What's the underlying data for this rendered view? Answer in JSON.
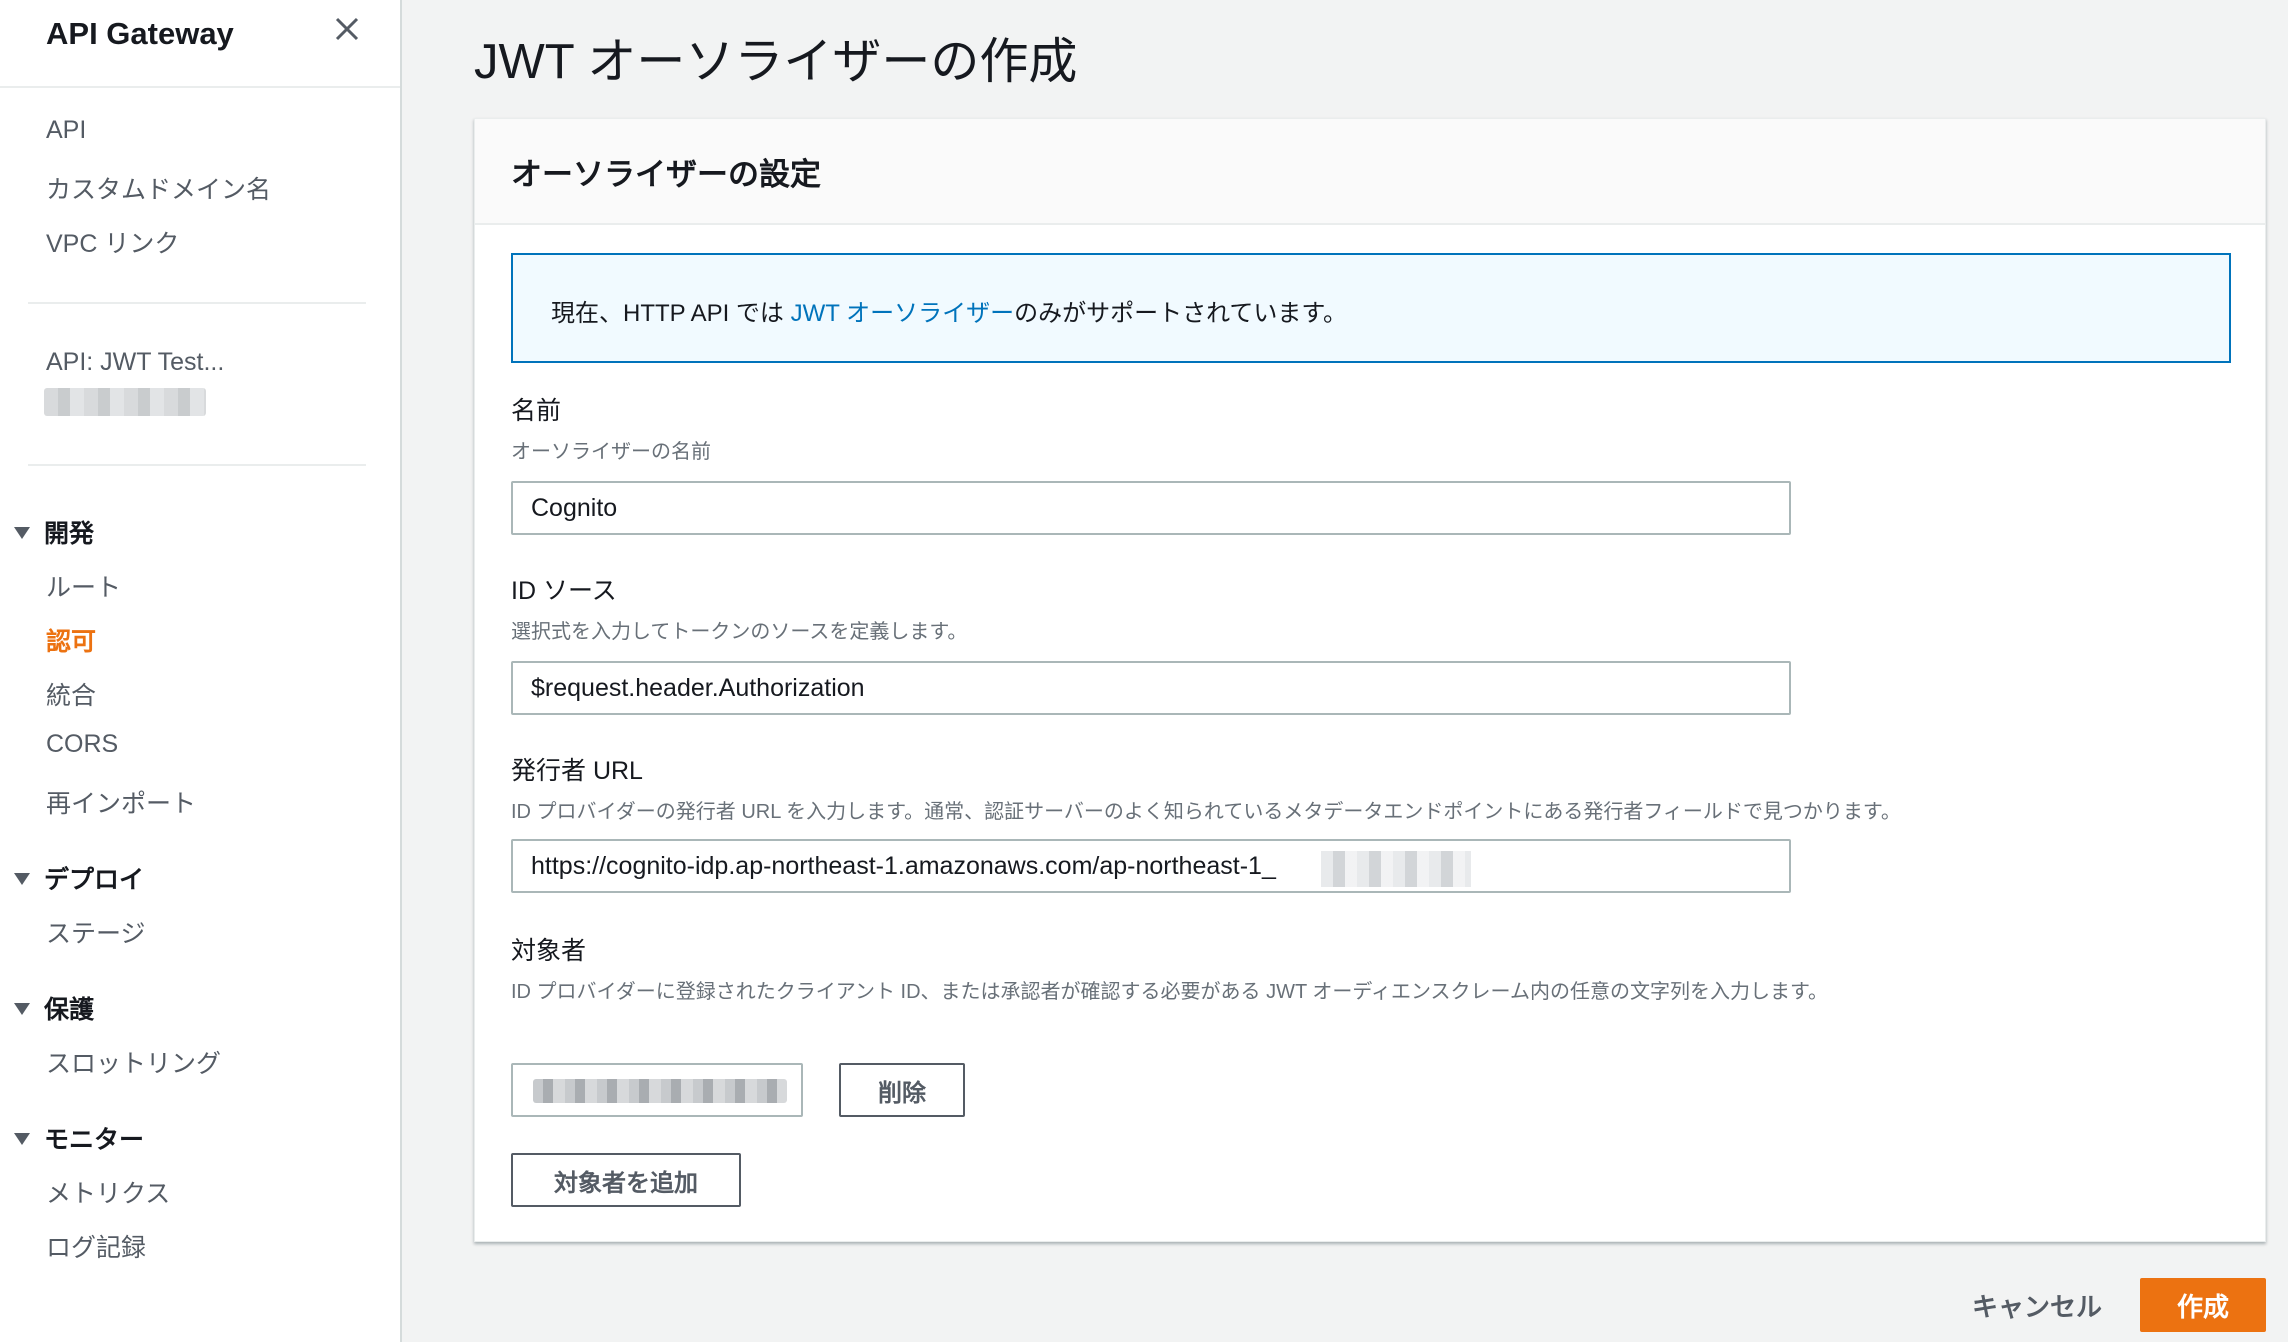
{
  "sidebar": {
    "title": "API Gateway",
    "top_links": [
      "API",
      "カスタムドメイン名",
      "VPC リンク"
    ],
    "api_name": "API: JWT Test...",
    "groups": [
      {
        "label": "開発",
        "items": [
          "ルート",
          "認可",
          "統合",
          "CORS",
          "再インポート"
        ],
        "active": "認可"
      },
      {
        "label": "デプロイ",
        "items": [
          "ステージ"
        ]
      },
      {
        "label": "保護",
        "items": [
          "スロットリング"
        ]
      },
      {
        "label": "モニター",
        "items": [
          "メトリクス",
          "ログ記録"
        ]
      }
    ]
  },
  "main": {
    "title": "JWT オーソライザーの作成",
    "panel_title": "オーソライザーの設定",
    "info": {
      "prefix": "現在、HTTP API では ",
      "link": "JWT オーソライザー",
      "suffix": "のみがサポートされています。"
    },
    "fields": {
      "name": {
        "label": "名前",
        "description": "オーソライザーの名前",
        "value": "Cognito"
      },
      "identity_source": {
        "label": "ID ソース",
        "description": "選択式を入力してトークンのソースを定義します。",
        "value": "$request.header.Authorization"
      },
      "issuer_url": {
        "label": "発行者 URL",
        "description": "ID プロバイダーの発行者 URL を入力します。通常、認証サーバーのよく知られているメタデータエンドポイントにある発行者フィールドで見つかります。",
        "value": "https://cognito-idp.ap-northeast-1.amazonaws.com/ap-northeast-1_"
      },
      "audience": {
        "label": "対象者",
        "description": "ID プロバイダーに登録されたクライアント ID、または承認者が確認する必要がある JWT オーディエンスクレーム内の任意の文字列を入力します。"
      }
    },
    "delete_label": "削除",
    "add_audience_label": "対象者を追加"
  },
  "footer": {
    "cancel_label": "キャンセル",
    "create_label": "作成"
  },
  "colors": {
    "accent": "#ec7211",
    "link": "#0073bb",
    "info_bg": "#f1faff"
  }
}
